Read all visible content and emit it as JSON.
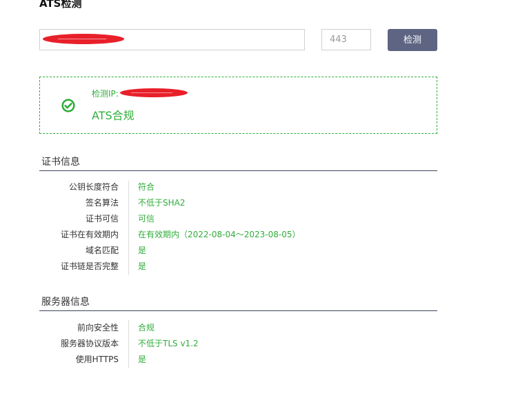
{
  "page": {
    "title": "ATS检测"
  },
  "form": {
    "domain_value": "",
    "port_placeholder": "443",
    "submit_label": "检测"
  },
  "result": {
    "ip_label": "检测IP:",
    "status": "ATS合规",
    "status_color": "#30ad3a"
  },
  "cert_section": {
    "title": "证书信息",
    "rows": [
      {
        "key": "公钥长度符合",
        "value": "符合"
      },
      {
        "key": "签名算法",
        "value": "不低于SHA2"
      },
      {
        "key": "证书可信",
        "value": "可信"
      },
      {
        "key": "证书在有效期内",
        "value": "在有效期内（2022-08-04～2023-08-05）"
      },
      {
        "key": "域名匹配",
        "value": "是"
      },
      {
        "key": "证书链是否完整",
        "value": "是"
      }
    ]
  },
  "server_section": {
    "title": "服务器信息",
    "rows": [
      {
        "key": "前向安全性",
        "value": "合规"
      },
      {
        "key": "服务器协议版本",
        "value": "不低于TLS v1.2"
      },
      {
        "key": "使用HTTPS",
        "value": "是"
      }
    ]
  },
  "colors": {
    "accent_green": "#30ad3a",
    "button_bg": "#5d6582",
    "section_rule": "#3b4557",
    "redaction": "#e8202a"
  },
  "icons": {
    "result": "check-circle-icon"
  }
}
